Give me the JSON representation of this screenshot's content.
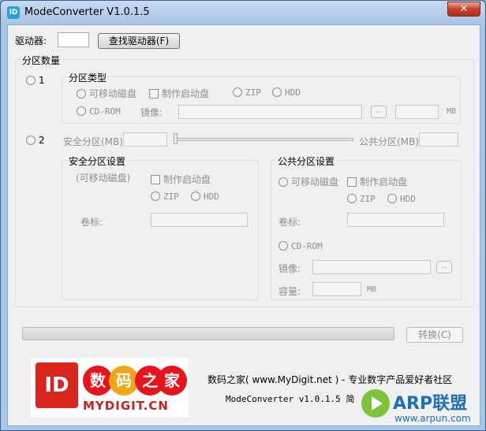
{
  "window": {
    "title": "ModeConverter V1.0.1.5",
    "close": "✕",
    "app_icon": "ID"
  },
  "top": {
    "drive_label": "驱动器:",
    "drive_value": "",
    "find_button": "查找驱动器(F)"
  },
  "partition_count": {
    "label": "分区数量",
    "option1": "1",
    "option2": "2"
  },
  "partition_type": {
    "label": "分区类型",
    "removable": "可移动磁盘",
    "make_boot": "制作启动盘",
    "zip": "ZIP",
    "hdd": "HDD",
    "cdrom": "CD-ROM",
    "image_label": "镜像:",
    "browse": "..",
    "mb": "MB"
  },
  "split": {
    "secure_label": "安全分区(MB)",
    "public_label": "公共分区(MB)"
  },
  "secure_settings": {
    "label": "安全分区设置",
    "removable": "(可移动磁盘)",
    "make_boot": "制作启动盘",
    "zip": "ZIP",
    "hdd": "HDD",
    "volume_label": "卷标:"
  },
  "public_settings": {
    "label": "公共分区设置",
    "removable": "可移动磁盘",
    "make_boot": "制作启动盘",
    "zip": "ZIP",
    "hdd": "HDD",
    "volume_label": "卷标:",
    "cdrom": "CD-ROM",
    "image_label": "镜像:",
    "browse": "..",
    "capacity_label": "容量:",
    "mb": "MB"
  },
  "progress": {
    "value": 0
  },
  "convert_button": "转换(C)",
  "footer": {
    "line1": "数码之家( www.MyDigit.net ) - 专业数字产品爱好者社区",
    "line2": "ModeConverter v1.0.1.5 简"
  },
  "logo": {
    "chars": [
      "数",
      "码",
      "之",
      "家"
    ],
    "text": "MYDIGIT.CN"
  },
  "watermark": {
    "title": "ARP联盟",
    "url": "www.arpun.com"
  },
  "colors": {
    "accent": "#d8261e",
    "watermark": "#1c6fb8"
  }
}
